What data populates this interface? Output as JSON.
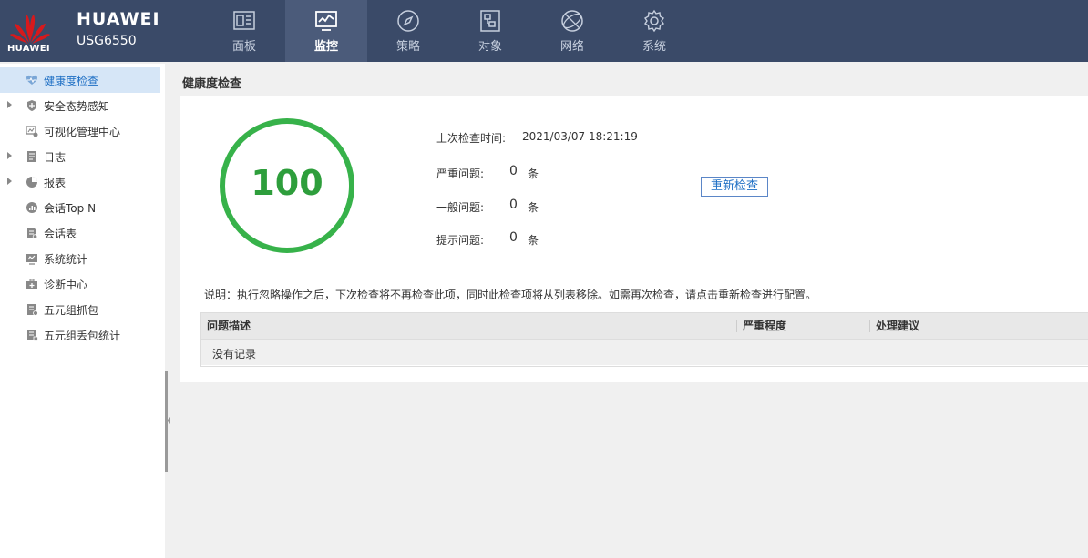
{
  "header": {
    "logo_text": "HUAWEI",
    "brand": "HUAWEI",
    "model": "USG6550"
  },
  "nav": {
    "items": [
      {
        "label": "面板",
        "icon": "dashboard-icon",
        "active": false
      },
      {
        "label": "监控",
        "icon": "monitor-icon",
        "active": true
      },
      {
        "label": "策略",
        "icon": "compass-icon",
        "active": false
      },
      {
        "label": "对象",
        "icon": "object-icon",
        "active": false
      },
      {
        "label": "网络",
        "icon": "globe-icon",
        "active": false
      },
      {
        "label": "系统",
        "icon": "gear-icon",
        "active": false
      }
    ]
  },
  "sidebar": {
    "items": [
      {
        "label": "健康度检查",
        "icon": "heart-pulse-icon",
        "active": true,
        "expandable": false
      },
      {
        "label": "安全态势感知",
        "icon": "shield-icon",
        "active": false,
        "expandable": true
      },
      {
        "label": "可视化管理中心",
        "icon": "visual-manage-icon",
        "active": false,
        "expandable": false
      },
      {
        "label": "日志",
        "icon": "log-icon",
        "active": false,
        "expandable": true
      },
      {
        "label": "报表",
        "icon": "pie-chart-icon",
        "active": false,
        "expandable": true
      },
      {
        "label": "会话Top N",
        "icon": "session-top-icon",
        "active": false,
        "expandable": false
      },
      {
        "label": "会话表",
        "icon": "session-table-icon",
        "active": false,
        "expandable": false
      },
      {
        "label": "系统统计",
        "icon": "system-stats-icon",
        "active": false,
        "expandable": false
      },
      {
        "label": "诊断中心",
        "icon": "diagnosis-icon",
        "active": false,
        "expandable": false
      },
      {
        "label": "五元组抓包",
        "icon": "capture-icon",
        "active": false,
        "expandable": false
      },
      {
        "label": "五元组丢包统计",
        "icon": "packet-loss-icon",
        "active": false,
        "expandable": false
      }
    ]
  },
  "main": {
    "title": "健康度检查",
    "score": "100",
    "last_check_label": "上次检查时间:",
    "last_check_value": "2021/03/07 18:21:19",
    "severe_label": "严重问题:",
    "severe_count": "0",
    "general_label": "一般问题:",
    "general_count": "0",
    "hint_label": "提示问题:",
    "hint_count": "0",
    "unit": "条",
    "recheck_button": "重新检查",
    "note": "说明：执行忽略操作之后，下次检查将不再检查此项，同时此检查项将从列表移除。如需再次检查，请点击重新检查进行配置。",
    "table": {
      "columns": [
        "问题描述",
        "严重程度",
        "处理建议"
      ],
      "empty_text": "没有记录"
    }
  },
  "colors": {
    "topbar": "#3a4a68",
    "score_green": "#2e9e3c",
    "accent_blue": "#1e6fc4",
    "logo_red": "#d7191c"
  }
}
